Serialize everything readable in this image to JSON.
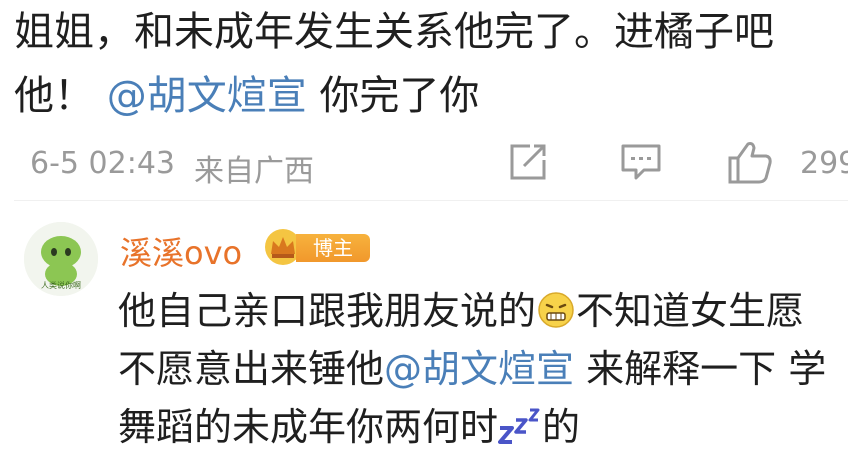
{
  "comment": {
    "text_before": "姐姐，和未成年发生关系他完了。进橘子吧他！",
    "mention": "@胡文煊宣",
    "text_after": " 你完了你",
    "time": "6-5 02:43",
    "location": "来自广西",
    "like_count": "299"
  },
  "reply": {
    "username": "溪溪ovo",
    "badge": "博主",
    "text_part1": "他自己亲口跟我朋友说的",
    "text_part2": "不知道女生愿不愿意出来锤他",
    "mention": "@胡文煊宣",
    "text_part3": " 来解释一下 学舞蹈的未成年你两何时",
    "text_part4": "的",
    "avatar_caption": "人类说你啊"
  },
  "icons": {
    "share": "share-icon",
    "reply": "comment-icon",
    "like": "thumbs-up-icon",
    "emoji": "grimace-emoji",
    "zzz": "sleep-zzz-emoji",
    "crown": "crown-icon"
  },
  "colors": {
    "mention": "#4a7fb8",
    "username": "#e8732a",
    "meta": "#9a9a9a",
    "badge": "#f1982c"
  }
}
